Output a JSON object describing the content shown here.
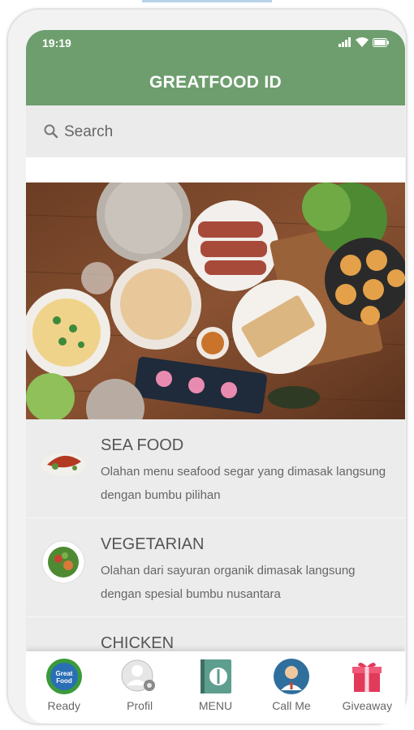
{
  "status": {
    "time": "19:19"
  },
  "app": {
    "title": "GREATFOOD ID"
  },
  "search": {
    "placeholder": "Search"
  },
  "menu_items": [
    {
      "title": "SEA FOOD",
      "desc": "Olahan menu seafood segar yang dimasak langsung dengan bumbu pilihan",
      "icon": "seafood-dish-icon"
    },
    {
      "title": "VEGETARIAN",
      "desc": "Olahan dari sayuran organik dimasak langsung dengan spesial bumbu nusantara",
      "icon": "vegetarian-dish-icon"
    },
    {
      "title": "CHICKEN",
      "desc": "",
      "icon": "chicken-dish-icon"
    }
  ],
  "bottom_nav": [
    {
      "label": "Ready",
      "icon": "greatfood-logo-icon"
    },
    {
      "label": "Profil",
      "icon": "profile-gear-icon"
    },
    {
      "label": "MENU",
      "icon": "menu-book-icon"
    },
    {
      "label": "Call Me",
      "icon": "call-person-icon"
    },
    {
      "label": "Giveaway",
      "icon": "gift-icon"
    }
  ],
  "colors": {
    "appbar": "#6e9e6e",
    "search_bg": "#ebebeb",
    "list_bg": "#ececec"
  }
}
